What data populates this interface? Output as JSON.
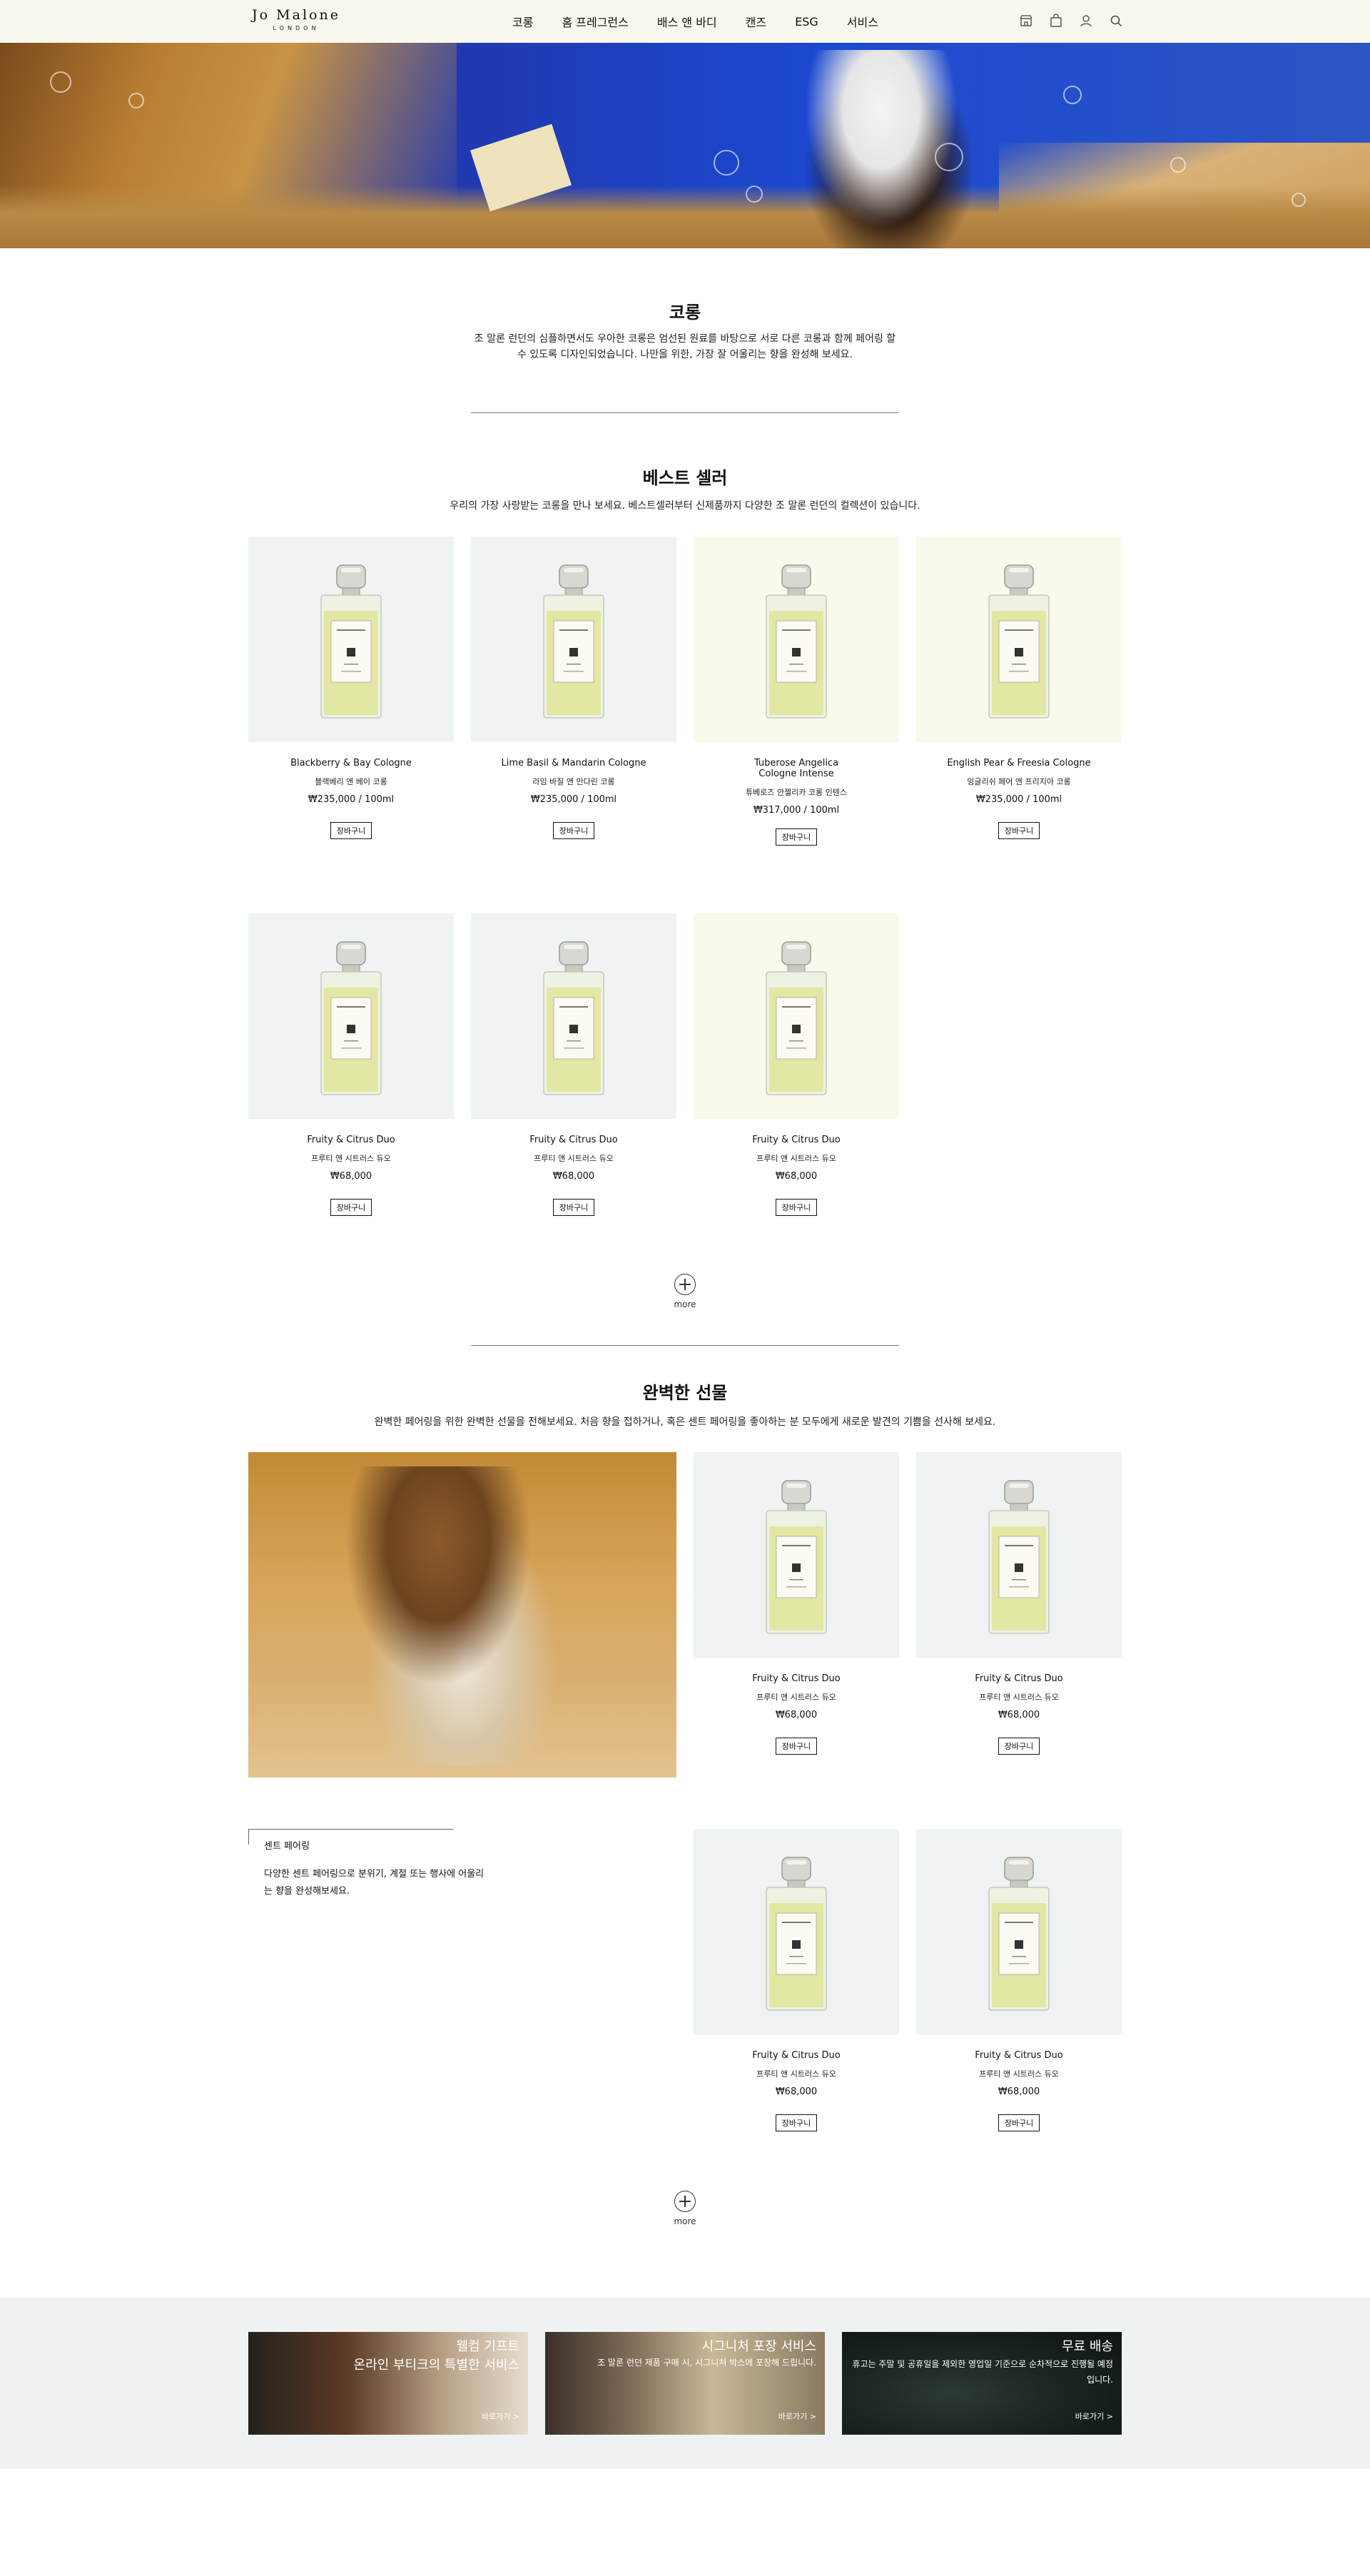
{
  "header": {
    "logo_main": "Jo Malone",
    "logo_sub": "LONDON",
    "nav": [
      "코롱",
      "홈 프레그런스",
      "배스 앤 바디",
      "캔즈",
      "ESG",
      "서비스"
    ]
  },
  "intro": {
    "title": "코롱",
    "desc": "조 말론 런던의 심플하면서도 우아한 코롱은 엄선된 원료를 바탕으로 서로 다른 코롱과 함께 페어링 할 수 있도록 디자인되었습니다. 나만을 위한, 가장 잘 어울리는 향을 완성해 보세요."
  },
  "bestseller": {
    "title": "베스트 셀러",
    "desc": "우리의 가장 사랑받는 코롱을 만나 보세요. 베스트셀러부터 신제품까지 다양한 조 말론 런던의 컬렉션이 있습니다.",
    "products": [
      {
        "en": "Blackberry & Bay Cologne",
        "ko": "블랙베리 앤 베이 코롱",
        "price": "₩235,000 / 100ml",
        "cart": "장바구니"
      },
      {
        "en": "Lime Basil & Mandarin Cologne",
        "ko": "라임 바질 앤 만다린 코롱",
        "price": "₩235,000 / 100ml",
        "cart": "장바구니"
      },
      {
        "en": "Tuberose Angelica\nCologne Intense",
        "ko": "튜베로즈 안젤리카 코롱 인텐스",
        "price": "₩317,000 / 100ml",
        "cart": "장바구니"
      },
      {
        "en": "English Pear & Freesia Cologne",
        "ko": "잉글리쉬 페어 앤 프리지아 코롱",
        "price": "₩235,000 / 100ml",
        "cart": "장바구니"
      },
      {
        "en": "Fruity & Citrus Duo",
        "ko": "프루티 앤 시트러스 듀오",
        "price": "₩68,000",
        "cart": "장바구니"
      },
      {
        "en": "Fruity & Citrus Duo",
        "ko": "프루티 앤 시트러스 듀오",
        "price": "₩68,000",
        "cart": "장바구니"
      },
      {
        "en": "Fruity & Citrus Duo",
        "ko": "프루티 앤 시트러스 듀오",
        "price": "₩68,000",
        "cart": "장바구니"
      }
    ],
    "more": "more"
  },
  "gift": {
    "title": "완벽한 선물",
    "desc": "완벽한 페어링을 위한 완벽한 선물을 전해보세요. 처음 향을 접하거나, 혹은 센트 페어링을 좋아하는 분 모두에게 새로운 발견의 기쁨을 선사해 보세요.",
    "products": [
      {
        "en": "Fruity & Citrus Duo",
        "ko": "프루티 앤 시트러스 듀오",
        "price": "₩68,000",
        "cart": "장바구니"
      },
      {
        "en": "Fruity & Citrus Duo",
        "ko": "프루티 앤 시트러스 듀오",
        "price": "₩68,000",
        "cart": "장바구니"
      },
      {
        "en": "Fruity & Citrus Duo",
        "ko": "프루티 앤 시트러스 듀오",
        "price": "₩68,000",
        "cart": "장바구니"
      },
      {
        "en": "Fruity & Citrus Duo",
        "ko": "프루티 앤 시트러스 듀오",
        "price": "₩68,000",
        "cart": "장바구니"
      }
    ],
    "scent_title": "센트 페어링",
    "scent_desc": "다양한 센트 페어링으로 분위기, 계절 또는 행사에 어울리는 향을 완성해보세요.",
    "more": "more"
  },
  "banners": [
    {
      "title": "웰컴 기프트",
      "sub": "온라인 부티크의 특별한 서비스",
      "go": "바로가기 >"
    },
    {
      "title": "시그니처 포장 서비스",
      "sub": "조 말론 런던 제품 구매 시, 시그니처 박스에 포장해 드립니다.",
      "go": "바로가기 >"
    },
    {
      "title": "무료 배송",
      "sub": "휴고는 주말 및 공휴일을 제외한 영업일 기준으로 순차적으로 진행될 예정입니다.",
      "go": "바로가기 >"
    }
  ],
  "colors": {
    "header_bg": "#f8f8ec",
    "card_grey": "#f0f3f3",
    "card_cream": "#f9f9ec",
    "band_bg": "#eff2f2"
  }
}
